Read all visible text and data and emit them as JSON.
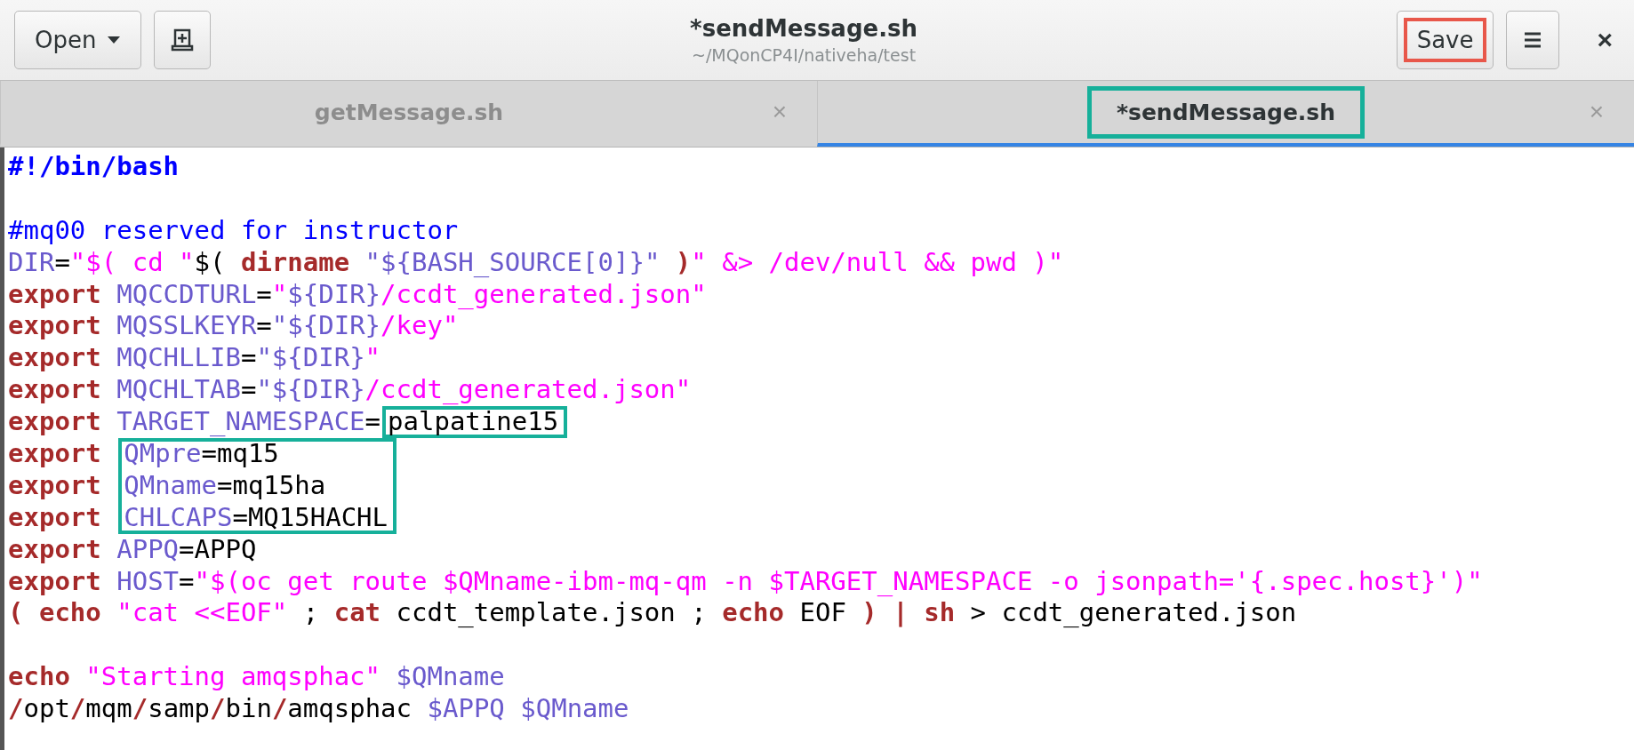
{
  "header": {
    "open_button": {
      "label": "Open"
    },
    "title": "*sendMessage.sh",
    "subtitle": "~/MQonCP4I/nativeha/test",
    "save_button": {
      "label": "Save",
      "highlighted": true
    },
    "close": "×"
  },
  "tabs": [
    {
      "label": "getMessage.sh",
      "selected": false,
      "close": "×"
    },
    {
      "label": "*sendMessage.sh",
      "selected": true,
      "close": "×",
      "highlighted": true
    }
  ],
  "editor": {
    "lines": [
      {
        "tokens": [
          {
            "kind": "shebang",
            "text": "#!/bin/bash"
          }
        ]
      },
      {
        "kind": "blank"
      },
      {
        "tokens": [
          {
            "kind": "comment",
            "text": "#mq00 reserved for instructor"
          }
        ]
      },
      {
        "tokens": [
          {
            "kind": "variable",
            "text": "DIR"
          },
          {
            "kind": "plain",
            "text": "="
          },
          {
            "kind": "string",
            "text": "\"$( cd \""
          },
          {
            "kind": "plain",
            "text": "$("
          },
          {
            "kind": "keyword",
            "text": " dirname "
          },
          {
            "kind": "variable",
            "text": "\"${BASH_SOURCE[0]}\""
          },
          {
            "kind": "keyword",
            "text": " )"
          },
          {
            "kind": "string",
            "text": "\" &> /dev/null && pwd )\""
          }
        ]
      },
      {
        "tokens": [
          {
            "kind": "keyword",
            "text": "export "
          },
          {
            "kind": "variable",
            "text": "MQCCDTURL"
          },
          {
            "kind": "plain",
            "text": "="
          },
          {
            "kind": "string",
            "text": "\""
          },
          {
            "kind": "variable",
            "text": "${DIR}"
          },
          {
            "kind": "string",
            "text": "/ccdt_generated.json\""
          }
        ]
      },
      {
        "tokens": [
          {
            "kind": "keyword",
            "text": "export "
          },
          {
            "kind": "variable",
            "text": "MQSSLKEYR"
          },
          {
            "kind": "plain",
            "text": "="
          },
          {
            "kind": "variable",
            "text": "\"${DIR}"
          },
          {
            "kind": "string",
            "text": "/key\""
          }
        ]
      },
      {
        "tokens": [
          {
            "kind": "keyword",
            "text": "export "
          },
          {
            "kind": "variable",
            "text": "MQCHLLIB"
          },
          {
            "kind": "plain",
            "text": "="
          },
          {
            "kind": "variable",
            "text": "\"${DIR}"
          },
          {
            "kind": "string",
            "text": "\""
          }
        ]
      },
      {
        "tokens": [
          {
            "kind": "keyword",
            "text": "export "
          },
          {
            "kind": "variable",
            "text": "MQCHLTAB"
          },
          {
            "kind": "plain",
            "text": "="
          },
          {
            "kind": "variable",
            "text": "\"${DIR}"
          },
          {
            "kind": "string",
            "text": "/ccdt_generated.json\""
          }
        ]
      },
      {
        "tokens": [
          {
            "kind": "keyword",
            "text": "export "
          },
          {
            "kind": "variable",
            "text": "TARGET_NAMESPACE"
          },
          {
            "kind": "plain",
            "text": "="
          },
          {
            "kind": "plain",
            "text": "palpatine15",
            "boxed": true
          }
        ]
      },
      {
        "tokens": [
          {
            "kind": "keyword",
            "text": "export "
          },
          {
            "kind": "variable",
            "text": "QMpre",
            "boxed": true
          },
          {
            "kind": "plain",
            "text": "=mq15",
            "boxed": true
          }
        ]
      },
      {
        "tokens": [
          {
            "kind": "keyword",
            "text": "export "
          },
          {
            "kind": "variable",
            "text": "QMname",
            "boxed": true
          },
          {
            "kind": "plain",
            "text": "=mq15ha",
            "boxed": true
          }
        ]
      },
      {
        "tokens": [
          {
            "kind": "keyword",
            "text": "export "
          },
          {
            "kind": "variable",
            "text": "CHLCAPS",
            "boxed": true
          },
          {
            "kind": "plain",
            "text": "=MQ15HACHL",
            "boxed": true
          }
        ]
      },
      {
        "tokens": [
          {
            "kind": "keyword",
            "text": "export "
          },
          {
            "kind": "variable",
            "text": "APPQ"
          },
          {
            "kind": "plain",
            "text": "=APPQ"
          }
        ]
      },
      {
        "tokens": [
          {
            "kind": "keyword",
            "text": "export "
          },
          {
            "kind": "variable",
            "text": "HOST"
          },
          {
            "kind": "plain",
            "text": "="
          },
          {
            "kind": "string",
            "text": "\"$(oc get route $QMname-ibm-mq-qm -n $TARGET_NAMESPACE -o jsonpath='{.spec.host}')\""
          }
        ]
      },
      {
        "tokens": [
          {
            "kind": "keyword",
            "text": "( echo "
          },
          {
            "kind": "string",
            "text": "\"cat <<EOF\""
          },
          {
            "kind": "plain",
            "text": " ; "
          },
          {
            "kind": "keyword",
            "text": "cat"
          },
          {
            "kind": "plain",
            "text": " ccdt_template.json ; "
          },
          {
            "kind": "keyword",
            "text": "echo"
          },
          {
            "kind": "plain",
            "text": " EOF "
          },
          {
            "kind": "keyword",
            "text": ") | sh"
          },
          {
            "kind": "plain",
            "text": " > ccdt_generated.json"
          }
        ]
      },
      {
        "kind": "blank"
      },
      {
        "tokens": [
          {
            "kind": "keyword",
            "text": "echo "
          },
          {
            "kind": "string",
            "text": "\"Starting amqsphac\" "
          },
          {
            "kind": "variable",
            "text": "$QMname"
          }
        ]
      },
      {
        "tokens": [
          {
            "kind": "keyword",
            "text": "/"
          },
          {
            "kind": "plain",
            "text": "opt"
          },
          {
            "kind": "keyword",
            "text": "/"
          },
          {
            "kind": "plain",
            "text": "mqm"
          },
          {
            "kind": "keyword",
            "text": "/"
          },
          {
            "kind": "plain",
            "text": "samp"
          },
          {
            "kind": "keyword",
            "text": "/"
          },
          {
            "kind": "plain",
            "text": "bin"
          },
          {
            "kind": "keyword",
            "text": "/"
          },
          {
            "kind": "plain",
            "text": "amqsphac "
          },
          {
            "kind": "variable",
            "text": "$APPQ $QMname"
          }
        ]
      }
    ]
  }
}
